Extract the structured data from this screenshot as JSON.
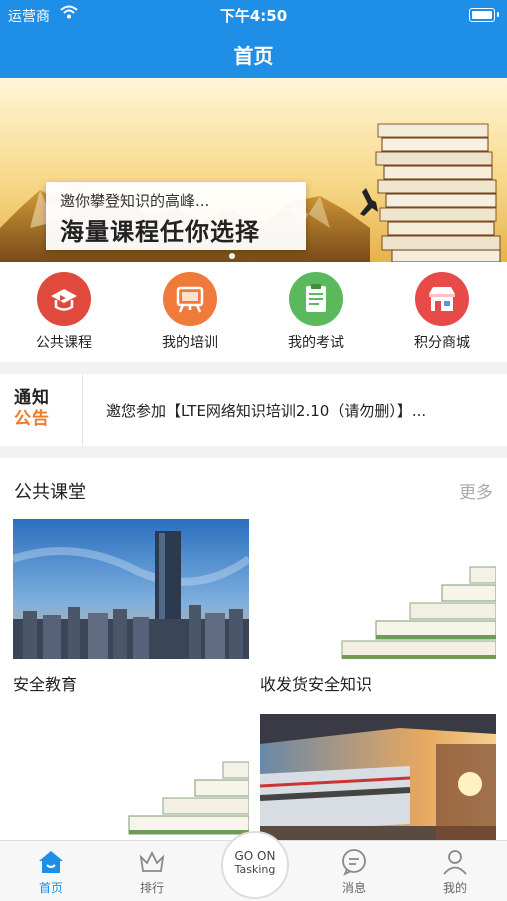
{
  "status": {
    "carrier": "运营商",
    "time": "下午4:50"
  },
  "nav": {
    "title": "首页"
  },
  "banner": {
    "line1": "邀你攀登知识的高峰...",
    "line2": "海量课程任你选择"
  },
  "menu": [
    {
      "label": "公共课程",
      "icon": "public-course-icon",
      "color": "#e04a3c"
    },
    {
      "label": "我的培训",
      "icon": "my-training-icon",
      "color": "#f07a3a"
    },
    {
      "label": "我的考试",
      "icon": "my-exam-icon",
      "color": "#5cb85c"
    },
    {
      "label": "积分商城",
      "icon": "points-mall-icon",
      "color": "#e84a4a"
    }
  ],
  "notice": {
    "badge_top": "通知",
    "badge_bottom": "公告",
    "text": "邀您参加【LTE网络知识培训2.10（请勿删）】..."
  },
  "section": {
    "title": "公共课堂",
    "more": "更多"
  },
  "cards": [
    {
      "title": "安全教育"
    },
    {
      "title": "收发货安全知识"
    }
  ],
  "tabs": [
    {
      "label": "首页"
    },
    {
      "label": "排行"
    },
    {
      "label": "消息"
    },
    {
      "label": "我的"
    }
  ],
  "go_button": {
    "line1": "GO ON",
    "line2": "Tasking"
  },
  "colors": {
    "brand": "#1e8ee6",
    "accent_orange": "#f07a2a"
  }
}
